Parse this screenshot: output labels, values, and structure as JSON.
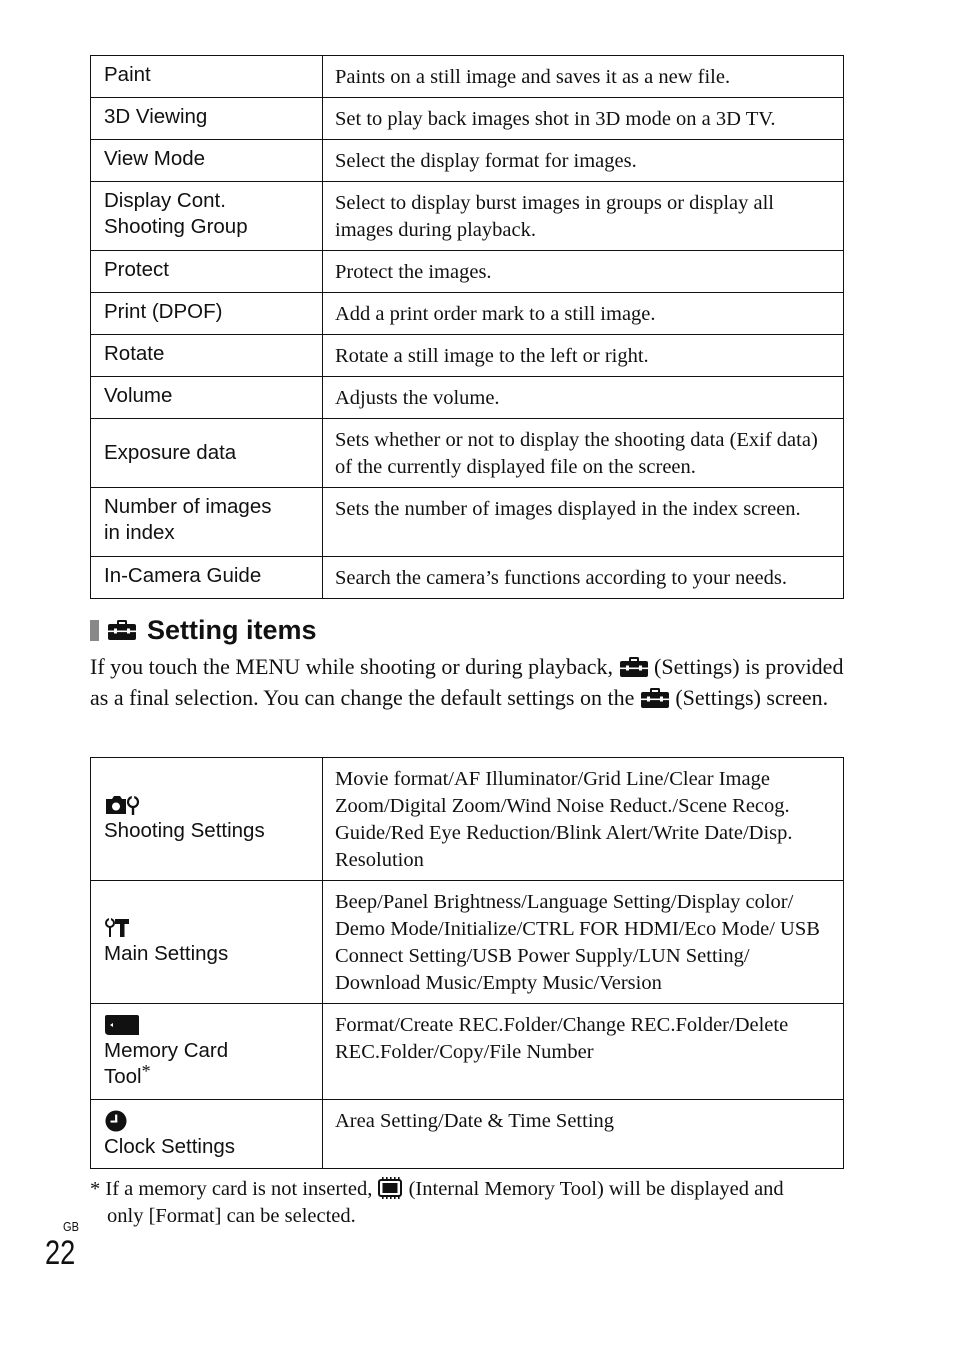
{
  "playback_table": {
    "rows": [
      {
        "item": "Paint",
        "description": "Paints on a still image and saves it as a new file."
      },
      {
        "item": "3D Viewing",
        "description": "Set to play back images shot in 3D mode on a 3D TV."
      },
      {
        "item": "View Mode",
        "description": "Select the display format for images."
      },
      {
        "item": "Display Cont. Shooting Group",
        "item_line1": "Display Cont.",
        "item_line2": "Shooting Group",
        "description": "Select to display burst images in groups or display all images during playback."
      },
      {
        "item": "Protect",
        "description": "Protect the images."
      },
      {
        "item": "Print (DPOF)",
        "description": "Add a print order mark to a still image."
      },
      {
        "item": "Rotate",
        "description": "Rotate a still image to the left or right."
      },
      {
        "item": "Volume",
        "description": "Adjusts the volume."
      },
      {
        "item": "Exposure data",
        "description": "Sets whether or not to display the shooting data (Exif data) of the currently displayed file on the screen."
      },
      {
        "item": "Number of images in index",
        "item_line1": "Number of images",
        "item_line2": "in index",
        "description": "Sets the number of images displayed in the index screen."
      },
      {
        "item": "In-Camera Guide",
        "description": "Search the camera’s functions according to your needs."
      }
    ]
  },
  "section": {
    "icon": "toolbox-icon",
    "title": "Setting items",
    "intro_part1": "If you touch the MENU while shooting or during playback,",
    "intro_part2": "(Settings) is provided as a final selection. You can change the default settings on the",
    "intro_part3": "(Settings) screen."
  },
  "settings_table": {
    "rows": [
      {
        "icon": "camera-wrench-icon",
        "label": "Shooting Settings",
        "description": "Movie format/AF Illuminator/Grid Line/Clear Image Zoom/Digital Zoom/Wind Noise Reduct./Scene Recog. Guide/Red Eye Reduction/Blink Alert/Write Date/Disp. Resolution"
      },
      {
        "icon": "wrench-hammer-icon",
        "label": "Main Settings",
        "description": "Beep/Panel Brightness/Language Setting/Display color/ Demo Mode/Initialize/CTRL FOR HDMI/Eco Mode/ USB Connect Setting/USB Power Supply/LUN Setting/ Download Music/Empty Music/Version"
      },
      {
        "icon": "memory-card-icon",
        "label_line1": "Memory Card",
        "label_line2": "Tool",
        "label_mark": "*",
        "description": "Format/Create REC.Folder/Change REC.Folder/Delete REC.Folder/Copy/File Number"
      },
      {
        "icon": "clock-icon",
        "label": "Clock Settings",
        "description": "Area Setting/Date & Time Setting"
      }
    ]
  },
  "footnote": {
    "mark": "*",
    "part1": "If a memory card is not inserted,",
    "icon": "internal-memory-icon",
    "part2": "(Internal Memory Tool) will be displayed and",
    "line2": "only [Format] can be selected."
  },
  "page": {
    "region": "GB",
    "number": "22"
  }
}
